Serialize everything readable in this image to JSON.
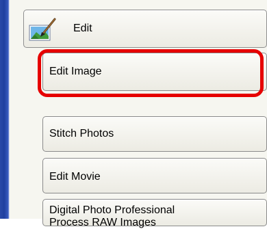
{
  "header": {
    "label": "Edit",
    "icon": "edit-image-icon"
  },
  "menu": {
    "items": [
      {
        "label": "Edit Image",
        "highlighted": true
      },
      {
        "label": "Stitch Photos"
      },
      {
        "label": "Edit Movie"
      },
      {
        "line1": "Digital Photo Professional",
        "line2": "Process RAW Images"
      }
    ]
  },
  "colors": {
    "highlight": "#e60000",
    "sidebar": "#1f3f9f"
  }
}
